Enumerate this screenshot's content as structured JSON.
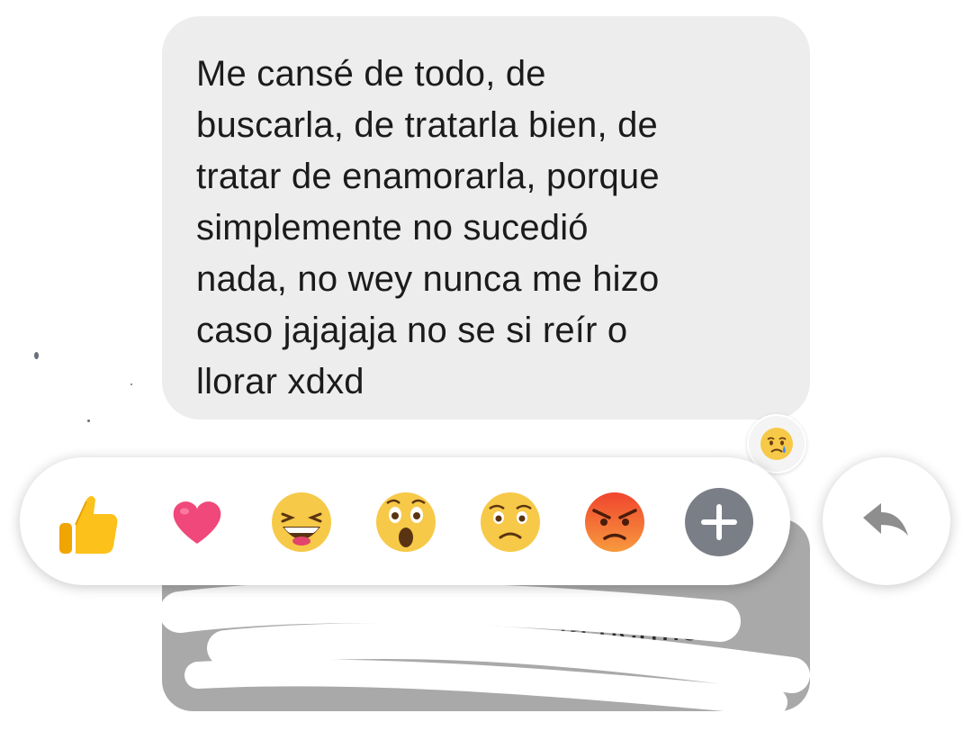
{
  "message": {
    "text": "Me cansé de todo, de\nbuscarla, de tratarla bien, de\ntratar de enamorarla, porque\nsimplemente no sucedió\nnada, no wey nunca me hizo\ncaso jajajaja no se si reír o\nllorar xdxd",
    "reaction_icon": "sad-tear-emoji-icon"
  },
  "second_message": {
    "visible_fragment": "ía hermo"
  },
  "reaction_bar": {
    "reactions": [
      {
        "name": "like",
        "icon": "thumbs-up-icon"
      },
      {
        "name": "love",
        "icon": "heart-icon"
      },
      {
        "name": "haha",
        "icon": "laughing-emoji-icon"
      },
      {
        "name": "wow",
        "icon": "surprised-emoji-icon"
      },
      {
        "name": "sad",
        "icon": "sad-emoji-icon"
      },
      {
        "name": "angry",
        "icon": "angry-emoji-icon"
      },
      {
        "name": "more",
        "icon": "plus-icon"
      }
    ]
  },
  "reply": {
    "icon": "reply-arrow-icon"
  },
  "colors": {
    "bubble": "#ededed",
    "like": "#f5b800",
    "love": "#f0487a",
    "emoji_yellow": "#f7c948",
    "angry": "#f2623a",
    "plus_bg": "#7a7f87",
    "reply_icon": "#8e8e8e"
  }
}
